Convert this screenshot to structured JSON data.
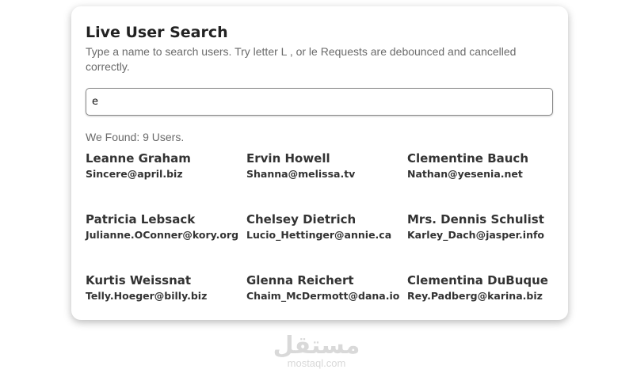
{
  "header": {
    "title": "Live User Search",
    "subtitle": "Type a name to search users. Try letter L , or le Requests are debounced and cancelled correctly."
  },
  "search": {
    "value": "e",
    "placeholder": ""
  },
  "results": {
    "summary": "We Found: 9 Users.",
    "users": [
      {
        "name": "Leanne Graham",
        "email": "Sincere@april.biz"
      },
      {
        "name": "Ervin Howell",
        "email": "Shanna@melissa.tv"
      },
      {
        "name": "Clementine Bauch",
        "email": "Nathan@yesenia.net"
      },
      {
        "name": "Patricia Lebsack",
        "email": "Julianne.OConner@kory.org"
      },
      {
        "name": "Chelsey Dietrich",
        "email": "Lucio_Hettinger@annie.ca"
      },
      {
        "name": "Mrs. Dennis Schulist",
        "email": "Karley_Dach@jasper.info"
      },
      {
        "name": "Kurtis Weissnat",
        "email": "Telly.Hoeger@billy.biz"
      },
      {
        "name": "Glenna Reichert",
        "email": "Chaim_McDermott@dana.io"
      },
      {
        "name": "Clementina DuBuque",
        "email": "Rey.Padberg@karina.biz"
      }
    ]
  },
  "watermark": {
    "arabic": "مستقل",
    "latin": "mostaql.com"
  }
}
